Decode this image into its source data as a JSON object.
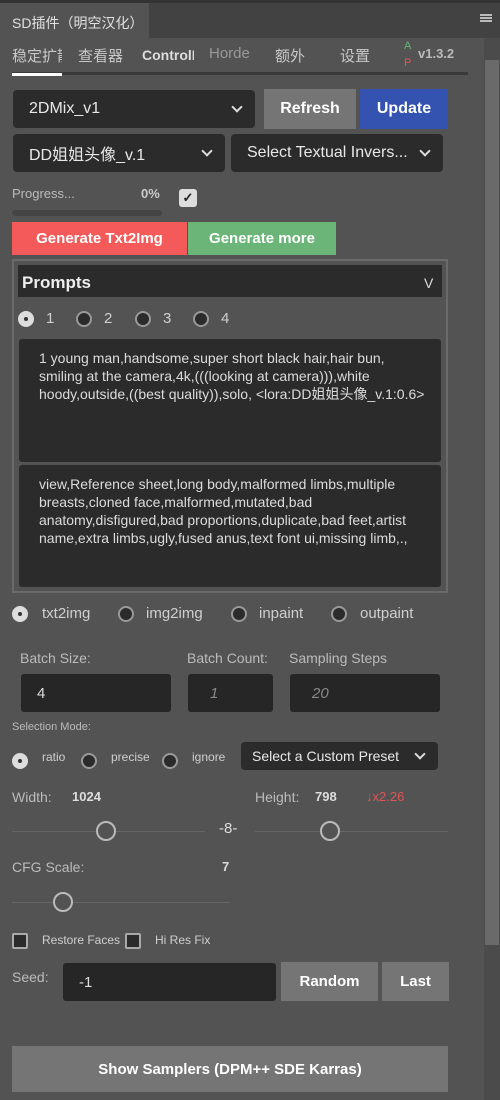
{
  "panel": {
    "title": "SD插件（明空汉化）"
  },
  "tabs": [
    {
      "label": "稳定扩散"
    },
    {
      "label": "查看器"
    },
    {
      "label": "ControlNet"
    },
    {
      "label": "Horde"
    },
    {
      "label": "额外"
    },
    {
      "label": "设置"
    }
  ],
  "version": {
    "a": "A",
    "p": "P",
    "label": "v1.3.2"
  },
  "model": {
    "selected": "2DMix_v1"
  },
  "buttons": {
    "refresh": "Refresh",
    "update": "Update",
    "generate": "Generate Txt2Img",
    "generate_more": "Generate more",
    "random": "Random",
    "last": "Last",
    "show_samplers": "Show Samplers (DPM++ SDE Karras)"
  },
  "lora": {
    "selected": "DD姐姐头像_v.1"
  },
  "textual_inversion": {
    "selected": "Select Textual Invers..."
  },
  "progress": {
    "label": "Progress...",
    "value": "0%",
    "fraction": 0,
    "checkbox_checked": true
  },
  "prompts": {
    "title": "Prompts",
    "toggle": "V",
    "tabs": [
      "1",
      "2",
      "3",
      "4"
    ],
    "selected": 0,
    "positive": "1 young man,handsome,super short black hair,hair bun, smiling at the camera,4k,(((looking at camera))),white hoody,outside,((best quality)),solo, <lora:DD姐姐头像_v.1:0.6>",
    "negative": "view,Reference sheet,long body,malformed limbs,multiple breasts,cloned face,malformed,mutated,bad anatomy,disfigured,bad proportions,duplicate,bad feet,artist name,extra limbs,ugly,fused anus,text font ui,missing limb,.,"
  },
  "modes": {
    "options": [
      "txt2img",
      "img2img",
      "inpaint",
      "outpaint"
    ],
    "selected": 0
  },
  "batch": {
    "size_label": "Batch Size:",
    "size": "4",
    "count_label": "Batch Count:",
    "count_placeholder": "1",
    "steps_label": "Sampling Steps",
    "steps_placeholder": "20"
  },
  "selection_mode": {
    "label": "Selection Mode:",
    "options": [
      "ratio",
      "precise",
      "ignore"
    ],
    "selected": 0,
    "preset": "Select a Custom Preset"
  },
  "size": {
    "width_label": "Width:",
    "width": "1024",
    "height_label": "Height:",
    "height": "798",
    "scale": "↓x2.26"
  },
  "cfg": {
    "label": "CFG Scale:",
    "value": "7"
  },
  "options": {
    "restore_faces": "Restore Faces",
    "hires_fix": "Hi Res Fix"
  },
  "seed": {
    "label": "Seed:",
    "value": "-1"
  },
  "colors": {
    "generate": "#f55a5a",
    "generate_more": "#6ab577",
    "update": "#3453b0",
    "refresh": "#757575",
    "scale": "#e05555"
  }
}
